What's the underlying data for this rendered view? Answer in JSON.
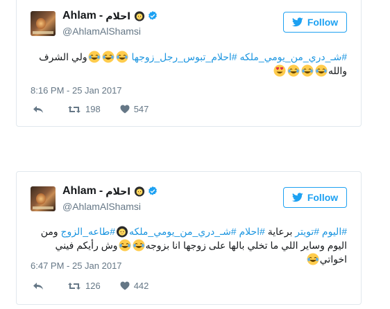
{
  "tweets": [
    {
      "name": "Ahlam",
      "separator": "-",
      "name_ar": "احلام",
      "handle": "@AhlamAlShamsi",
      "follow_label": "Follow",
      "text_parts": [
        {
          "t": "#شـ_دري_من_يومي_ملكه",
          "tag": true
        },
        {
          "t": " ",
          "tag": false
        },
        {
          "t": "#احلام_تبوس_رجل_زوجها",
          "tag": true
        },
        {
          "t": " ",
          "tag": false
        },
        {
          "emoji": "joy"
        },
        {
          "emoji": "joy"
        },
        {
          "emoji": "joy"
        },
        {
          "t": "ولي الشرف والله",
          "tag": false
        },
        {
          "emoji": "joy"
        },
        {
          "emoji": "joy"
        },
        {
          "emoji": "joy"
        },
        {
          "emoji": "heart-eyes"
        }
      ],
      "timestamp": "8:16 PM - 25 Jan 2017",
      "retweets": "198",
      "likes": "547"
    },
    {
      "name": "Ahlam",
      "separator": "-",
      "name_ar": "احلام",
      "handle": "@AhlamAlShamsi",
      "follow_label": "Follow",
      "text_parts": [
        {
          "t": "#اليوم",
          "tag": true
        },
        {
          "t": " ",
          "tag": false
        },
        {
          "t": "#تويتر",
          "tag": true
        },
        {
          "t": " برعاية ",
          "tag": false
        },
        {
          "t": "#احلام",
          "tag": true
        },
        {
          "t": " ",
          "tag": false
        },
        {
          "t": "#شـ_دري_من_يومي_ملكه",
          "tag": true
        },
        {
          "emoji": "woman-hijab"
        },
        {
          "t": "#طاعه_الزوج",
          "tag": true
        },
        {
          "t": " ومن اليوم وساير اللي ما تخلي بالها على زوجها انا بزوجه",
          "tag": false
        },
        {
          "emoji": "joy"
        },
        {
          "emoji": "joy"
        },
        {
          "t": "وش رأيكم فيني اخواتي",
          "tag": false
        },
        {
          "emoji": "joy"
        }
      ],
      "timestamp": "6:47 PM - 25 Jan 2017",
      "retweets": "126",
      "likes": "442"
    }
  ],
  "icons": {
    "reply": "reply-icon",
    "retweet": "retweet-icon",
    "like": "heart-icon",
    "verified": "verified-badge-icon",
    "follow": "twitter-bird-icon"
  },
  "colors": {
    "accent": "#1da1f2",
    "hashtag": "#1b95e0",
    "muted": "#657786",
    "text": "#14171a"
  }
}
